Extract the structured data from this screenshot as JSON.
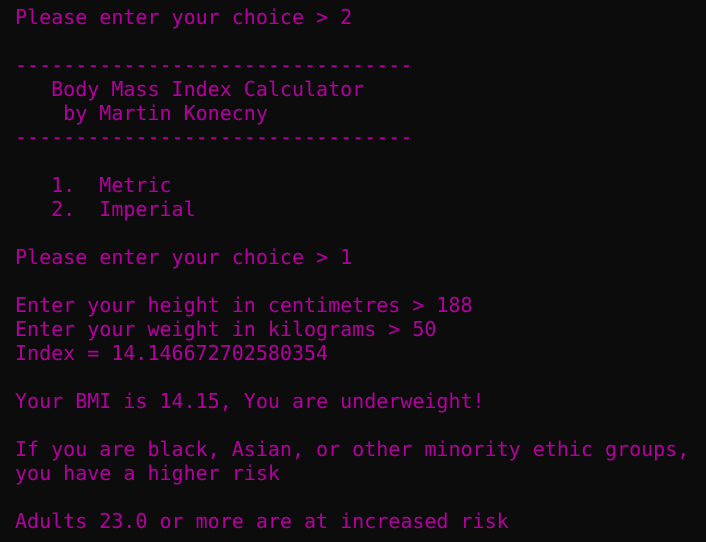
{
  "terminal": {
    "text_color": "#b4009e",
    "background": "#0c0c0c",
    "lines": [
      "Please enter your choice > 2",
      "",
      "---------------------------------",
      "   Body Mass Index Calculator",
      "    by Martin Konecny",
      "---------------------------------",
      "",
      "   1.  Metric",
      "   2.  Imperial",
      "",
      "Please enter your choice > 1",
      "",
      "Enter your height in centimetres > 188",
      "Enter your weight in kilograms > 50",
      "Index = 14.146672702580354",
      "",
      "Your BMI is 14.15, You are underweight!",
      "",
      "If you are black, Asian, or other minority ethic groups,",
      "you have a higher risk",
      "",
      "Adults 23.0 or more are at increased risk"
    ]
  }
}
